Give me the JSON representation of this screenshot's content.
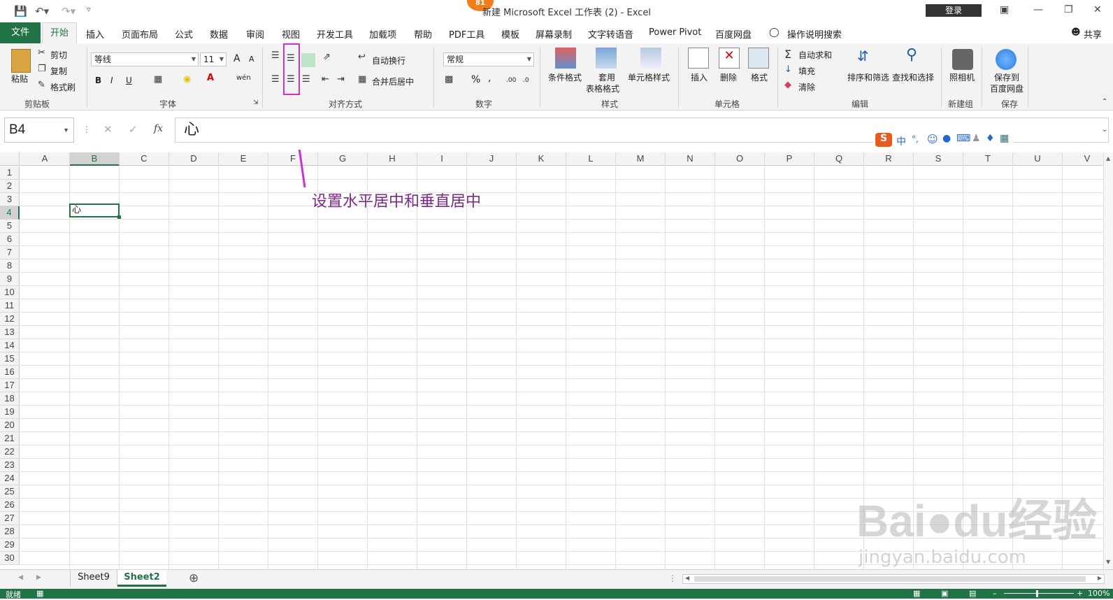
{
  "titlebar": {
    "badge": "81",
    "title": "新建 Microsoft Excel 工作表 (2)  -  Excel",
    "login": "登录"
  },
  "tabs": {
    "file": "文件",
    "home": "开始",
    "items": [
      "插入",
      "页面布局",
      "公式",
      "数据",
      "审阅",
      "视图",
      "开发工具",
      "加载项",
      "帮助",
      "PDF工具",
      "模板",
      "屏幕录制",
      "文字转语音",
      "Power Pivot",
      "百度网盘"
    ],
    "tell_me": "操作说明搜索",
    "share": "共享"
  },
  "ribbon": {
    "clipboard": {
      "paste": "粘贴",
      "cut": "剪切",
      "copy": "复制",
      "format_painter": "格式刷",
      "label": "剪贴板"
    },
    "font": {
      "name": "等线",
      "size": "11",
      "label": "字体",
      "bold": "B",
      "italic": "I",
      "underline": "U",
      "grow": "A",
      "shrink": "A",
      "phonetic": "wén"
    },
    "alignment": {
      "wrap": "自动换行",
      "merge": "合并后居中",
      "label": "对齐方式"
    },
    "number": {
      "format": "常规",
      "percent": "%",
      "comma": ",",
      "label": "数字",
      "inc_decimal": ".00",
      "dec_decimal": ".0"
    },
    "styles": {
      "cond": "条件格式",
      "table": "套用",
      "table2": "表格格式",
      "cell": "单元格样式",
      "label": "样式"
    },
    "cells": {
      "insert": "插入",
      "delete": "删除",
      "format": "格式",
      "label": "单元格"
    },
    "editing": {
      "autosum": "自动求和",
      "fill": "填充",
      "clear": "清除",
      "sort": "排序和筛选",
      "find": "查找和选择",
      "label": "编辑"
    },
    "newgroup": {
      "camera": "照相机",
      "label": "新建组"
    },
    "save": {
      "baidu": "保存到",
      "baidu2": "百度网盘",
      "label": "保存"
    }
  },
  "formula_bar": {
    "name_box": "B4",
    "fx": "fx",
    "value": "心"
  },
  "ime": {
    "zhong": "中",
    "dot": "°,"
  },
  "sheet": {
    "columns": [
      "A",
      "B",
      "C",
      "D",
      "E",
      "F",
      "G",
      "H",
      "I",
      "J",
      "K",
      "L",
      "M",
      "N",
      "O",
      "P",
      "Q",
      "R",
      "S",
      "T",
      "U",
      "V"
    ],
    "rows": [
      "1",
      "2",
      "3",
      "4",
      "5",
      "6",
      "7",
      "8",
      "9",
      "10",
      "11",
      "12",
      "13",
      "14",
      "15",
      "16",
      "17",
      "18",
      "19",
      "20",
      "21",
      "22",
      "23",
      "24",
      "25",
      "26",
      "27",
      "28",
      "29",
      "30"
    ],
    "active_cell_value": "心"
  },
  "annotation": {
    "text": "设置水平居中和垂直居中"
  },
  "sheettabs": {
    "tabs": [
      "Sheet9",
      "Sheet2"
    ],
    "active": "Sheet2"
  },
  "statusbar": {
    "ready": "就绪",
    "zoom": "100%"
  },
  "watermark": {
    "line1": "Bai",
    "line2": "du",
    "line3": "经验",
    "url": "jingyan.baidu.com"
  },
  "colors": {
    "excel_green": "#217346",
    "annotation": "#7b2a8a",
    "highlight": "#cc33cc"
  }
}
